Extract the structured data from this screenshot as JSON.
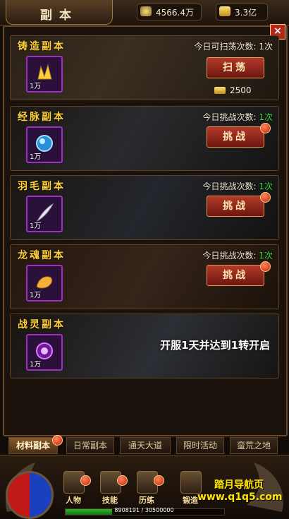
{
  "header": {
    "title": "副本",
    "coins": "4566.4万",
    "ingots": "3.3亿",
    "close_icon": "close-icon"
  },
  "dungeons": [
    {
      "name": "铸造副本",
      "qty": "1万",
      "counter_label": "今日可扫荡次数:",
      "counter_value": "1次",
      "button": "扫荡",
      "cost": "2500",
      "icon": "gold-crystal-icon"
    },
    {
      "name": "经脉副本",
      "qty": "1万",
      "counter_label": "今日挑战次数:",
      "counter_value": "1次",
      "button": "挑战",
      "icon": "blue-orb-icon"
    },
    {
      "name": "羽毛副本",
      "qty": "1万",
      "counter_label": "今日挑战次数:",
      "counter_value": "1次",
      "button": "挑战",
      "icon": "feather-icon"
    },
    {
      "name": "龙魂副本",
      "qty": "1万",
      "counter_label": "今日挑战次数:",
      "counter_value": "1次",
      "button": "挑战",
      "icon": "dragon-soul-icon"
    },
    {
      "name": "战灵副本",
      "qty": "1万",
      "notice": "开服1天并达到1转开启",
      "icon": "purple-spirit-icon"
    }
  ],
  "tabs": [
    "材料副本",
    "日常副本",
    "通天大道",
    "限时活动",
    "蛮荒之地"
  ],
  "bottom_menu": [
    "人物",
    "技能",
    "历练",
    "锻造"
  ],
  "exp": {
    "text": "8908191 / 30500000",
    "fraction": 0.292
  },
  "watermark": {
    "line1": "踏月导航页",
    "line2": "www.q1q5.com"
  },
  "colors": {
    "accent_gold": "#ffcf3a",
    "count_green": "#33dd33",
    "button_red": "#b23a2a",
    "quality_purple": "#9e2ec4"
  }
}
